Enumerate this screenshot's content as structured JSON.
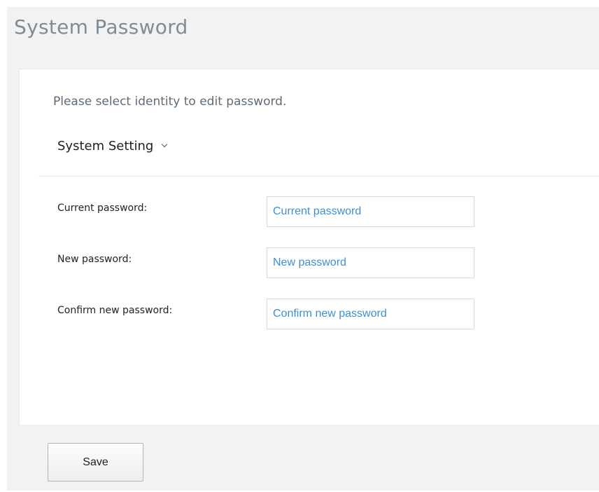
{
  "page": {
    "title": "System Password"
  },
  "form": {
    "instruction": "Please select identity to edit password.",
    "identity_select": {
      "selected": "System Setting",
      "icon": "chevron-down-icon"
    },
    "fields": [
      {
        "label": "Current password:",
        "placeholder": "Current password",
        "value": ""
      },
      {
        "label": "New password:",
        "placeholder": "New password",
        "value": ""
      },
      {
        "label": "Confirm new password:",
        "placeholder": "Confirm new password",
        "value": ""
      }
    ]
  },
  "footer": {
    "save_label": "Save"
  },
  "colors": {
    "title": "#7e8c98",
    "placeholder": "#3d8fd1",
    "panel_background": "#f2f2f2"
  }
}
